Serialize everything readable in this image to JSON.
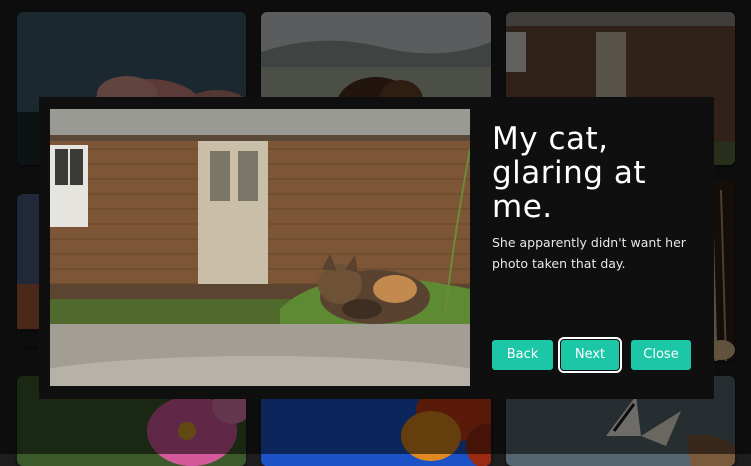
{
  "lightbox": {
    "title": "My cat, glaring at me.",
    "description": "She apparently didn't want her photo taken that day.",
    "buttons": {
      "back": "Back",
      "next": "Next",
      "close": "Close"
    },
    "accent_color": "#1cc7a8",
    "focused_button": "next"
  },
  "gallery": {
    "thumbnails": [
      {
        "subject": "clouds at dusk"
      },
      {
        "subject": "bison in grassland"
      },
      {
        "subject": "cat by cabin"
      },
      {
        "subject": "sunset silhouette"
      },
      {
        "subject": "hidden"
      },
      {
        "subject": "dried plant stems"
      },
      {
        "subject": "pink flower with bee"
      },
      {
        "subject": "autumn leaves against blue sky"
      },
      {
        "subject": "swallowtail butterfly"
      }
    ]
  }
}
